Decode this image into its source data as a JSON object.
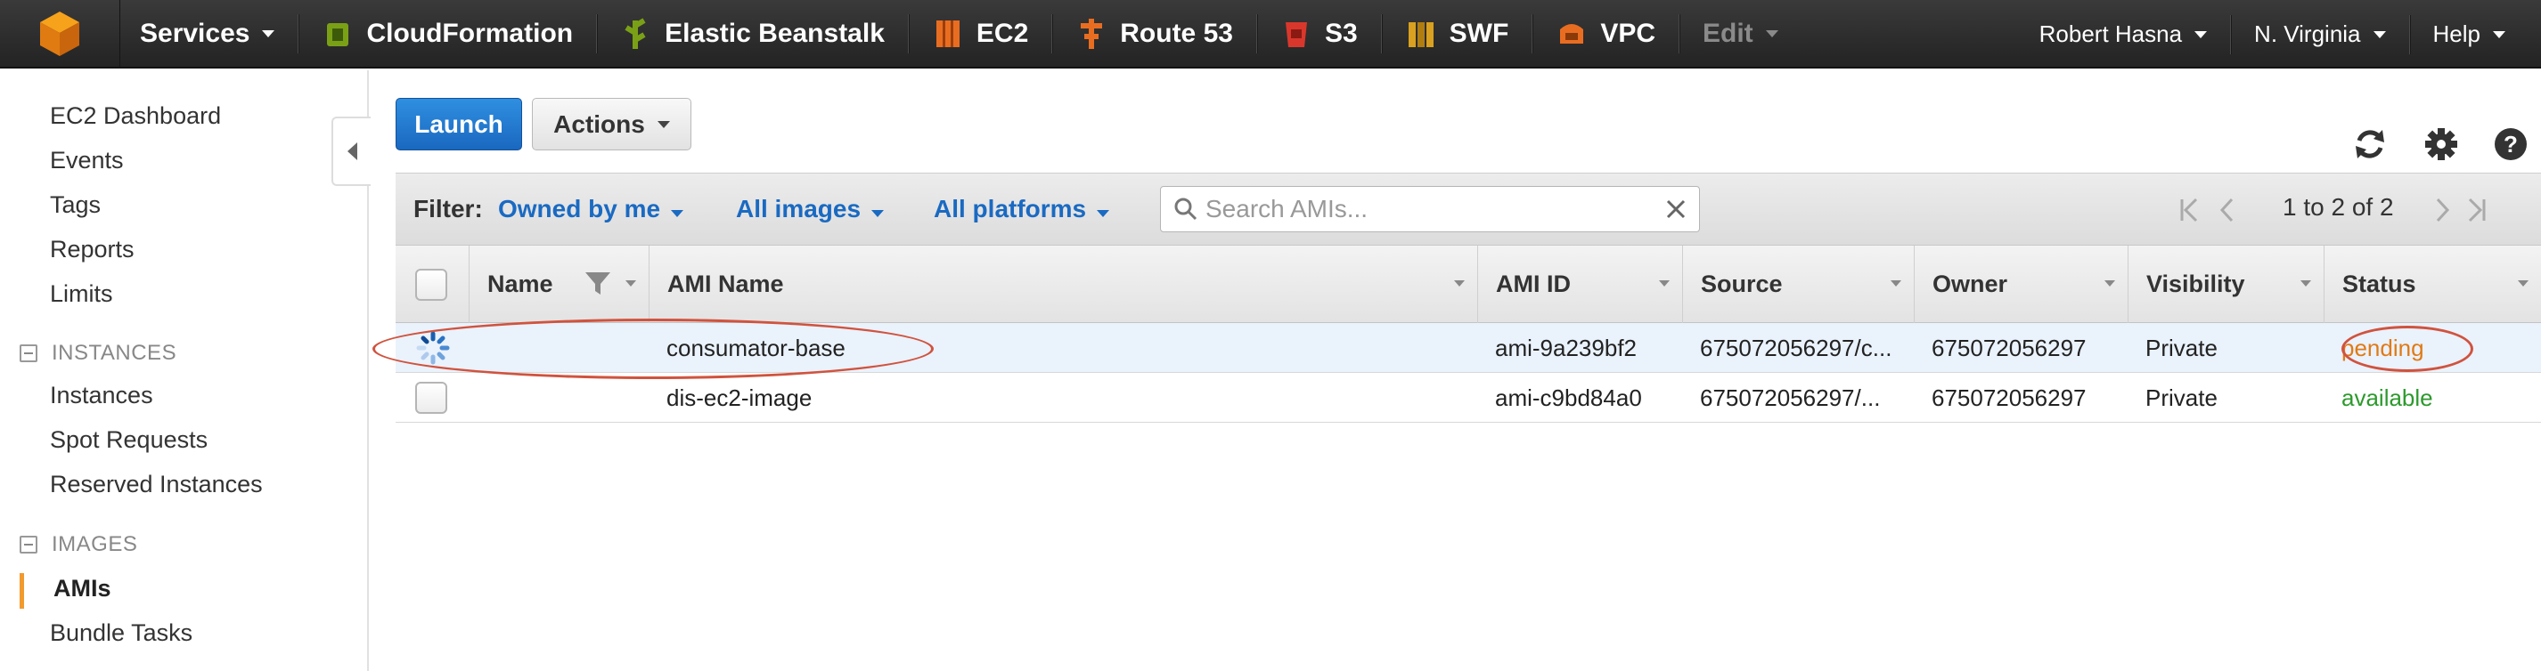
{
  "nav": {
    "services_label": "Services",
    "items": [
      {
        "label": "CloudFormation",
        "icon": "cloudformation-icon",
        "color": "#7aa116"
      },
      {
        "label": "Elastic Beanstalk",
        "icon": "beanstalk-icon",
        "color": "#7aa116"
      },
      {
        "label": "EC2",
        "icon": "ec2-icon",
        "color": "#e96d21"
      },
      {
        "label": "Route 53",
        "icon": "route53-icon",
        "color": "#e96d21"
      },
      {
        "label": "S3",
        "icon": "s3-icon",
        "color": "#d9372c"
      },
      {
        "label": "SWF",
        "icon": "swf-icon",
        "color": "#d9a11f"
      },
      {
        "label": "VPC",
        "icon": "vpc-icon",
        "color": "#e96d21"
      }
    ],
    "edit_label": "Edit",
    "user": "Robert Hasna",
    "region": "N. Virginia",
    "help": "Help"
  },
  "sidebar": {
    "top_items": [
      "EC2 Dashboard",
      "Events",
      "Tags",
      "Reports",
      "Limits"
    ],
    "instances_heading": "INSTANCES",
    "instances_items": [
      "Instances",
      "Spot Requests",
      "Reserved Instances"
    ],
    "images_heading": "IMAGES",
    "images_items": [
      "AMIs",
      "Bundle Tasks"
    ],
    "active_item": "AMIs"
  },
  "toolbar": {
    "launch_label": "Launch",
    "actions_label": "Actions"
  },
  "filter": {
    "label": "Filter:",
    "owned": "Owned by me",
    "images": "All images",
    "platforms": "All platforms",
    "search_placeholder": "Search AMIs...",
    "pagination": "1 to 2 of 2"
  },
  "table": {
    "columns": [
      "Name",
      "AMI Name",
      "AMI ID",
      "Source",
      "Owner",
      "Visibility",
      "Status"
    ],
    "rows": [
      {
        "name": "",
        "ami_name": "consumator-base",
        "ami_id": "ami-9a239bf2",
        "source": "675072056297/c...",
        "owner": "675072056297",
        "visibility": "Private",
        "status": "pending",
        "selected": true
      },
      {
        "name": "",
        "ami_name": "dis-ec2-image",
        "ami_id": "ami-c9bd84a0",
        "source": "675072056297/...",
        "owner": "675072056297",
        "visibility": "Private",
        "status": "available",
        "selected": false
      }
    ]
  },
  "colors": {
    "launch_button": "#1f77d0",
    "link_blue": "#1a6ac2",
    "pending": "#e07a16",
    "available": "#2c9a2c",
    "annotation": "#d0533e",
    "active_marker": "#f29a2e"
  }
}
